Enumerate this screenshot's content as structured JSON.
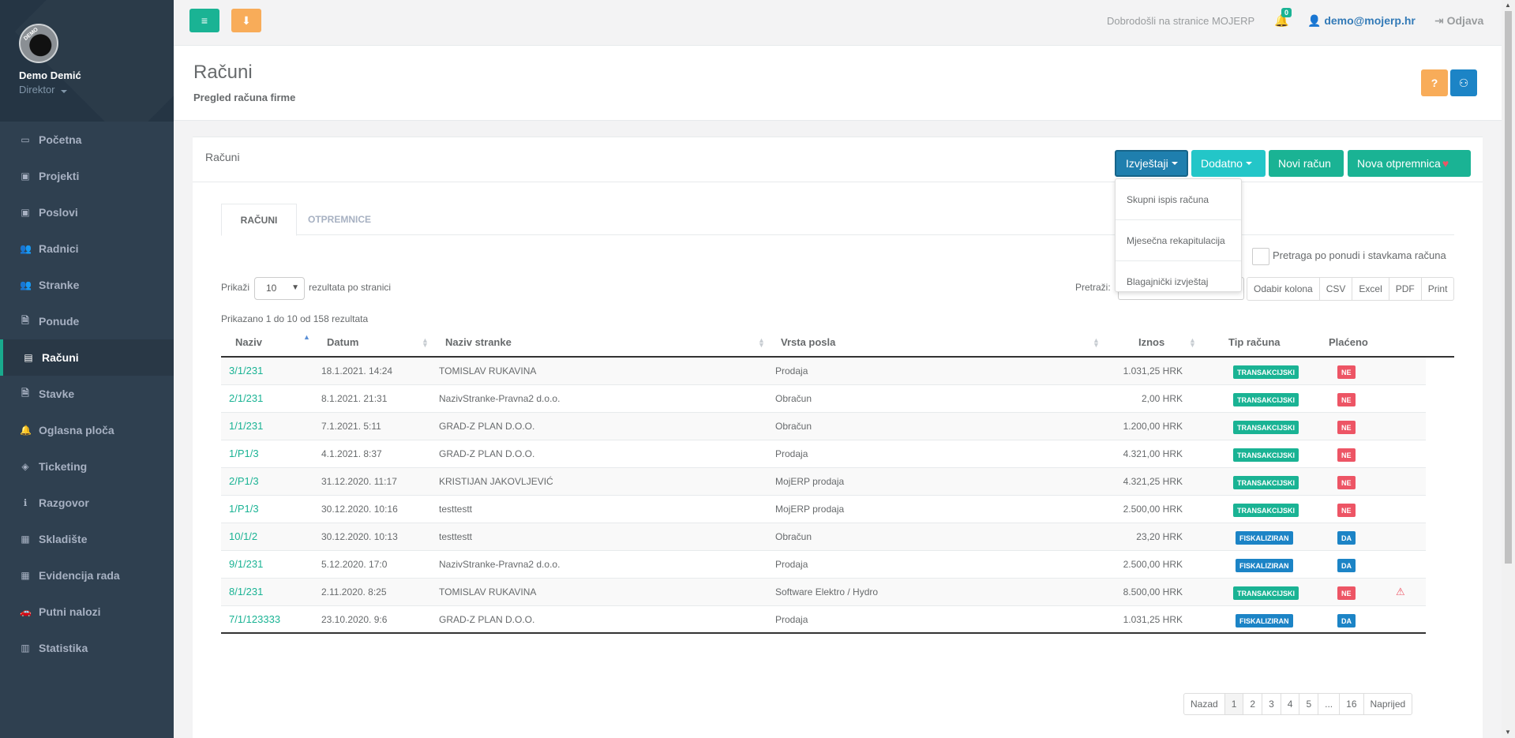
{
  "user": {
    "name": "Demo Demić",
    "role": "Direktor",
    "avatar_tag": "DEMO"
  },
  "sidebar": {
    "items": [
      {
        "label": "Početna",
        "icon": "laptop-icon",
        "glyph": "▭"
      },
      {
        "label": "Projekti",
        "icon": "briefcase-icon",
        "glyph": "▣"
      },
      {
        "label": "Poslovi",
        "icon": "briefcase-icon",
        "glyph": "▣"
      },
      {
        "label": "Radnici",
        "icon": "users-icon",
        "glyph": "👥"
      },
      {
        "label": "Stranke",
        "icon": "users-icon",
        "glyph": "👥"
      },
      {
        "label": "Ponude",
        "icon": "file-icon",
        "glyph": "🗎"
      },
      {
        "label": "Računi",
        "icon": "money-icon",
        "glyph": "▤"
      },
      {
        "label": "Stavke",
        "icon": "file-icon",
        "glyph": "🗎"
      },
      {
        "label": "Oglasna ploča",
        "icon": "bell-icon",
        "glyph": "🔔"
      },
      {
        "label": "Ticketing",
        "icon": "tag-icon",
        "glyph": "◈"
      },
      {
        "label": "Razgovor",
        "icon": "info-icon",
        "glyph": "ℹ"
      },
      {
        "label": "Skladište",
        "icon": "archive-icon",
        "glyph": "▦"
      },
      {
        "label": "Evidencija rada",
        "icon": "calendar-icon",
        "glyph": "▦"
      },
      {
        "label": "Putni nalozi",
        "icon": "car-icon",
        "glyph": "🚗"
      },
      {
        "label": "Statistika",
        "icon": "chart-icon",
        "glyph": "▥"
      }
    ],
    "active_index": 6
  },
  "topbar": {
    "menu_glyph": "≡",
    "download_glyph": "⬇",
    "welcome": "Dobrodošli na stranice MOJERP",
    "bell_glyph": "🔔",
    "notif_count": "0",
    "user_email": "👤 demo@mojerp.hr",
    "logout": "⇥ Odjava"
  },
  "page": {
    "title": "Računi",
    "subtitle": "Pregled računa firme",
    "help_label": "?",
    "profile_glyph": "⚇"
  },
  "box": {
    "title": "Računi",
    "buttons": {
      "izvjestaji": "Izvještaji",
      "dodatno": "Dodatno",
      "novi_racun": "Novi račun",
      "nova_otpremnica": "Nova otpremnica",
      "heart": "♥"
    }
  },
  "dropdown": {
    "items": [
      "Skupni ispis računa",
      "Mjesečna rekapitulacija",
      "Blagajnički izvještaj"
    ]
  },
  "tabs": {
    "racuni": "RAČUNI",
    "otpremnice": "OTPREMNICE"
  },
  "search_extra": {
    "label": "Pretraga po ponudi i stavkama računa"
  },
  "controls": {
    "show_prefix": "Prikaži",
    "show_value": "10",
    "show_suffix": "rezultata po stranici",
    "search_label": "Pretraži:",
    "exports": [
      "Odabir kolona",
      "CSV",
      "Excel",
      "PDF",
      "Print"
    ]
  },
  "info": "Prikazano 1 do 10 od 158 rezultata",
  "table": {
    "headers": [
      "Naziv",
      "Datum",
      "Naziv stranke",
      "Vrsta posla",
      "Iznos",
      "Tip računa",
      "Plaćeno"
    ],
    "rows": [
      {
        "naziv": "3/1/231",
        "datum": "18.1.2021. 14:24",
        "stranka": "TOMISLAV RUKAVINA",
        "vrsta": "Prodaja",
        "iznos": "1.031,25 HRK",
        "tip": "TRANSAKCIJSKI",
        "placeno": "NE",
        "warn": false
      },
      {
        "naziv": "2/1/231",
        "datum": "8.1.2021. 21:31",
        "stranka": "NazivStranke-Pravna2 d.o.o.",
        "vrsta": "Obračun",
        "iznos": "2,00 HRK",
        "tip": "TRANSAKCIJSKI",
        "placeno": "NE",
        "warn": false
      },
      {
        "naziv": "1/1/231",
        "datum": "7.1.2021. 5:11",
        "stranka": "GRAD-Z PLAN D.O.O.",
        "vrsta": "Obračun",
        "iznos": "1.200,00 HRK",
        "tip": "TRANSAKCIJSKI",
        "placeno": "NE",
        "warn": false
      },
      {
        "naziv": "1/P1/3",
        "datum": "4.1.2021. 8:37",
        "stranka": "GRAD-Z PLAN D.O.O.",
        "vrsta": "Prodaja",
        "iznos": "4.321,00 HRK",
        "tip": "TRANSAKCIJSKI",
        "placeno": "NE",
        "warn": false
      },
      {
        "naziv": "2/P1/3",
        "datum": "31.12.2020. 11:17",
        "stranka": "KRISTIJAN JAKOVLJEVIĆ",
        "vrsta": "MojERP prodaja",
        "iznos": "4.321,25 HRK",
        "tip": "TRANSAKCIJSKI",
        "placeno": "NE",
        "warn": false
      },
      {
        "naziv": "1/P1/3",
        "datum": "30.12.2020. 10:16",
        "stranka": "testtestt",
        "vrsta": "MojERP prodaja",
        "iznos": "2.500,00 HRK",
        "tip": "TRANSAKCIJSKI",
        "placeno": "NE",
        "warn": false
      },
      {
        "naziv": "10/1/2",
        "datum": "30.12.2020. 10:13",
        "stranka": "testtestt",
        "vrsta": "Obračun",
        "iznos": "23,20 HRK",
        "tip": "FISKALIZIRAN",
        "placeno": "DA",
        "warn": false
      },
      {
        "naziv": "9/1/231",
        "datum": "5.12.2020. 17:0",
        "stranka": "NazivStranke-Pravna2 d.o.o.",
        "vrsta": "Prodaja",
        "iznos": "2.500,00 HRK",
        "tip": "FISKALIZIRAN",
        "placeno": "DA",
        "warn": false
      },
      {
        "naziv": "8/1/231",
        "datum": "2.11.2020. 8:25",
        "stranka": "TOMISLAV RUKAVINA",
        "vrsta": "Software Elektro / Hydro",
        "iznos": "8.500,00 HRK",
        "tip": "TRANSAKCIJSKI",
        "placeno": "NE",
        "warn": true
      },
      {
        "naziv": "7/1/123333",
        "datum": "23.10.2020. 9:6",
        "stranka": "GRAD-Z PLAN D.O.O.",
        "vrsta": "Prodaja",
        "iznos": "1.031,25 HRK",
        "tip": "FISKALIZIRAN",
        "placeno": "DA",
        "warn": false
      }
    ]
  },
  "pagination": {
    "items": [
      "Nazad",
      "1",
      "2",
      "3",
      "4",
      "5",
      "...",
      "16",
      "Naprijed"
    ],
    "current": "1"
  },
  "colors": {
    "transakcijski": "#1ab394",
    "fiskaliziran": "#1c84c6",
    "ne": "#ed5565",
    "da": "#1c84c6",
    "link": "#1ab394"
  },
  "warn_glyph": "⚠"
}
